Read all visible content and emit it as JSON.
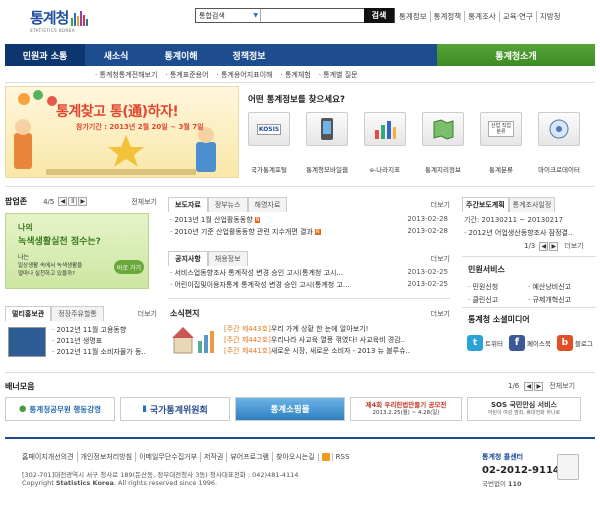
{
  "header": {
    "logo_title": "통계청",
    "logo_sub": "STATISTICS KOREA",
    "search_select": "통합검색",
    "search_button": "검색",
    "top_links": [
      "통계정보",
      "통계정책",
      "통계조사",
      "교육·연구",
      "지방청"
    ]
  },
  "gnb": {
    "items": [
      "민원과 소통",
      "새소식",
      "통계이해",
      "정책정보"
    ],
    "right": "통계청소개"
  },
  "subnav": [
    "· 통계청통계전해보기",
    "· 통계표준용어",
    "· 통계용어지표이해",
    "· 통계체험",
    "· 통계별 질문"
  ],
  "banner": {
    "title": "통계찾고 통(通)하자!",
    "period": "참가기간 : 2013년 2월 20일 ~ 3월 7일"
  },
  "services": {
    "heading": "어떤 통계정보를 찾으세요?",
    "items": [
      {
        "label": "국가통계포털",
        "icon": "kosis-icon",
        "badge": "KOSIS"
      },
      {
        "label": "통계청모바일웹",
        "icon": "mobile-icon",
        "badge": ""
      },
      {
        "label": "e-나라지표",
        "icon": "chart-icon",
        "badge": ""
      },
      {
        "label": "통계지리정보",
        "icon": "map-icon",
        "badge": ""
      },
      {
        "label": "통계분류",
        "icon": "classification-icon",
        "badge": "산업 직업 분류"
      },
      {
        "label": "마이크로데이터",
        "icon": "microdata-icon",
        "badge": ""
      }
    ]
  },
  "popup": {
    "title": "팝업존",
    "pager": "4/5",
    "more": "전체보기",
    "text1": "나의",
    "text2": "녹색생활실천 점수는?",
    "text3": "나는",
    "text4": "일상생활 속에서 녹색생활을",
    "text5": "얼마나 실천하고 있을까?",
    "button": "바로 가기"
  },
  "multimedia": {
    "tabs": [
      "멀티홍보관",
      "정장주유할통"
    ],
    "more": "더보기",
    "items": [
      "· 2012년 11월 고용동향",
      "· 2011년 생명표",
      "· 2012년 11월 소비자물가 동.."
    ]
  },
  "news": {
    "tabs": [
      "보도자료",
      "정부뉴스",
      "해명자료"
    ],
    "more": "더보기",
    "items": [
      {
        "title": "· 2013년 1월 산업활동동향",
        "date": "2013-02-28",
        "new": "N"
      },
      {
        "title": "· 2010년 기준 산업활동동향 관련 지수개편 결과",
        "date": "2013-02-28",
        "new": "N"
      }
    ]
  },
  "notice": {
    "tabs": [
      "공지사항",
      "채용정보"
    ],
    "more": "더보기",
    "items": [
      {
        "title": "· 서비스업동향조사 통계작성 변경 승인 고시(통계청 고시...",
        "date": "2013-02-25"
      },
      {
        "title": "· 어린이집및이용자통계 통계작성 변경 승인 고시(통계청 고...",
        "date": "2013-02-25"
      }
    ]
  },
  "letter": {
    "title": "소식편지",
    "more": "더보기",
    "items": [
      {
        "tag": "[주간 제443호]",
        "text": "우리 가계 상황 한 눈에 알아보기!"
      },
      {
        "tag": "[주간 제442호]",
        "text": "우리나라 사교육 열풍 꺾였다! 사교육비 경감.."
      },
      {
        "tag": "[주간 제441호]",
        "text": "새로운 시장, 새로운 소비자 - 2013 뉴 블루슈.."
      }
    ]
  },
  "weekly": {
    "tabs": [
      "주간보도계획",
      "통계조사일정"
    ],
    "period": "기간: 20130211 ~ 20130217",
    "item": "· 2012년 어업생산동향조사 잠정결..",
    "pager": "1/3",
    "more": "더보기"
  },
  "civil": {
    "title": "민원서비스",
    "items": [
      "· 민원신청",
      "· 예산낭비신고",
      "· 클린신고",
      "· 규제개혁신고"
    ]
  },
  "social": {
    "title": "통계청 소셜미디어",
    "items": [
      {
        "label": "트위터",
        "icon": "twitter-icon",
        "color": "#2aa3d8"
      },
      {
        "label": "페이스북",
        "icon": "facebook-icon",
        "color": "#3b5998"
      },
      {
        "label": "블로그",
        "icon": "blog-icon",
        "color": "#e34f24"
      }
    ]
  },
  "banners": {
    "title": "배너모음",
    "pager": "1/6",
    "more": "전체보기",
    "items": [
      {
        "text": "통계청공무원 행동강령",
        "color": "#2a6fb0"
      },
      {
        "text": "국가통계위원회",
        "color": "#2b4e8e"
      },
      {
        "text": "통계소핑몰",
        "color": "#2e7fc0"
      },
      {
        "text": "제4회 우리헌법만들기 공모전",
        "sub": "2013.2.25(월) ~ 4.28(일)",
        "color": "#c0392b"
      },
      {
        "text": "SOS 국민안심 서비스",
        "sub": "어린이 여성 범죄, 휴대전화 하나로",
        "color": "#333"
      }
    ]
  },
  "footer": {
    "links": [
      "홈페이지개선의견",
      "개인정보처리방침",
      "이메일무단수집거부",
      "저작권",
      "뷰어프로그램",
      "찾아오시는길"
    ],
    "rss": "RSS",
    "address": "[302-701]대전광역시 서구 청사로 189(둔산동, 정부대전청사 3동) 청사대표전화 : 042)481-4114",
    "copyright_prefix": "Copyright ",
    "copyright_brand": "Statistics Korea",
    "copyright_suffix": ". All rights reserved since 1996.",
    "call_title": "통계청 콜센터",
    "call_number": "02-2012-9114",
    "call_sub_label": "국번없이 ",
    "call_sub_num": "110"
  }
}
